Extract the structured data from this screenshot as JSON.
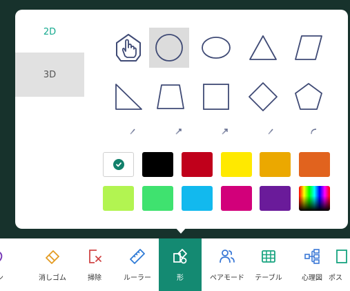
{
  "shape_panel": {
    "mode_tabs": [
      {
        "label": "2D"
      },
      {
        "label": "3D"
      }
    ],
    "shapes": [
      "hand-pointer-pentagon",
      "circle",
      "ellipse",
      "triangle",
      "parallelogram",
      "right-triangle",
      "trapezoid",
      "square",
      "diamond",
      "pentagon"
    ],
    "colors": [
      "#ffffff",
      "#000000",
      "#c0001b",
      "#ffe900",
      "#eba800",
      "#e1631e",
      "#b2f451",
      "#3fe26f",
      "#12b9ee",
      "#d2007a",
      "#6a1b9a",
      "spectrum"
    ]
  },
  "toolbar": {
    "items": [
      {
        "label": "ン"
      },
      {
        "label": "消しゴム"
      },
      {
        "label": "掃除"
      },
      {
        "label": "ルーラー"
      },
      {
        "label": "形"
      },
      {
        "label": "ペアモード"
      },
      {
        "label": "テーブル"
      },
      {
        "label": "心理図"
      },
      {
        "label": "ポス"
      }
    ]
  }
}
